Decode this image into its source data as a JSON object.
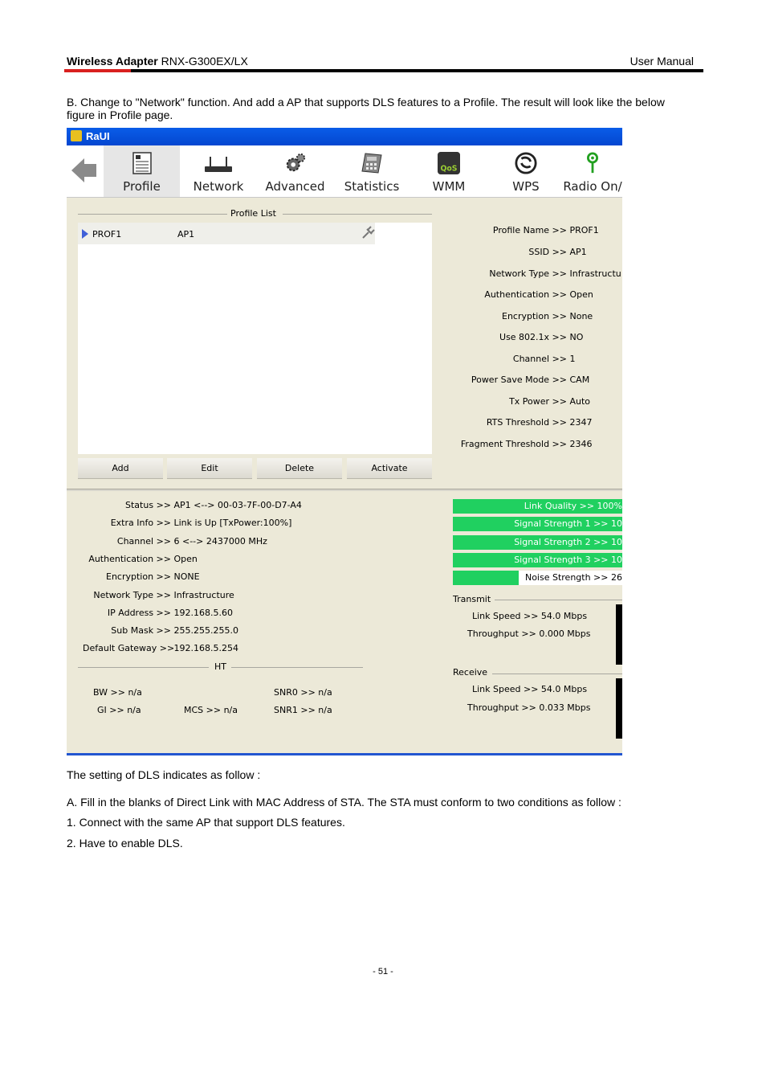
{
  "header": {
    "product_bold": "Wireless Adapter",
    "product_model": " RNX-G300EX/LX",
    "doc_type": "User Manual"
  },
  "intro": {
    "line1": "B. Change to \"Network\" function. And add a AP that supports DLS features to a Profile. The result will look like the below",
    "line2": "figure in Profile page."
  },
  "app": {
    "title": "RaUI",
    "toolbar": [
      {
        "label": "Profile",
        "icon": "profile-icon"
      },
      {
        "label": "Network",
        "icon": "network-icon"
      },
      {
        "label": "Advanced",
        "icon": "advanced-icon"
      },
      {
        "label": "Statistics",
        "icon": "statistics-icon"
      },
      {
        "label": "WMM",
        "icon": "qos-icon"
      },
      {
        "label": "WPS",
        "icon": "wps-icon"
      },
      {
        "label": "Radio On/",
        "icon": "radio-icon"
      }
    ],
    "profile_list": {
      "title": "Profile List",
      "rows": [
        {
          "name": "PROF1",
          "ssid": "AP1"
        }
      ],
      "buttons": {
        "add": "Add",
        "edit": "Edit",
        "delete": "Delete",
        "activate": "Activate"
      }
    },
    "profile_details": [
      {
        "k": "Profile Name >>",
        "v": "PROF1"
      },
      {
        "k": "SSID >>",
        "v": "AP1"
      },
      {
        "k": "Network Type >>",
        "v": "Infrastructu"
      },
      {
        "k": "Authentication >>",
        "v": "Open"
      },
      {
        "k": "Encryption >>",
        "v": "None"
      },
      {
        "k": "Use 802.1x >>",
        "v": "NO"
      },
      {
        "k": "Channel >>",
        "v": "1"
      },
      {
        "k": "Power Save Mode >>",
        "v": "CAM"
      },
      {
        "k": "Tx Power >>",
        "v": "Auto"
      },
      {
        "k": "RTS Threshold >>",
        "v": "2347"
      },
      {
        "k": "Fragment Threshold >>",
        "v": "2346"
      }
    ],
    "status": [
      {
        "k": "Status >>",
        "v": "AP1 <--> 00-03-7F-00-D7-A4"
      },
      {
        "k": "Extra Info >>",
        "v": "Link is Up [TxPower:100%]"
      },
      {
        "k": "Channel >>",
        "v": "6 <--> 2437000 MHz"
      },
      {
        "k": "Authentication >>",
        "v": "Open"
      },
      {
        "k": "Encryption >>",
        "v": "NONE"
      },
      {
        "k": "Network Type >>",
        "v": "Infrastructure"
      },
      {
        "k": "IP Address >>",
        "v": "192.168.5.60"
      },
      {
        "k": "Sub Mask >>",
        "v": "255.255.255.0"
      },
      {
        "k": "Default Gateway >>",
        "v": "192.168.5.254"
      }
    ],
    "ht": {
      "title": "HT",
      "bw": "BW >> n/a",
      "gi": "GI >> n/a",
      "mcs": "MCS >> n/a",
      "snr0": "SNR0 >> n/a",
      "snr1": "SNR1 >> n/a"
    },
    "signal_bars": [
      {
        "label": "Link Quality >> 100%",
        "level": 1.0
      },
      {
        "label": "Signal Strength 1 >> 10",
        "level": 1.0
      },
      {
        "label": "Signal Strength 2 >> 10",
        "level": 1.0
      },
      {
        "label": "Signal Strength 3 >> 10",
        "level": 1.0
      },
      {
        "label": "Noise Strength >> 26",
        "level": 0.39
      }
    ],
    "transmit": {
      "title": "Transmit",
      "link_speed": "Link Speed >>  54.0 Mbps",
      "throughput": "Throughput >>  0.000 Mbps"
    },
    "receive": {
      "title": "Receive",
      "link_speed": "Link Speed >>  54.0 Mbps",
      "throughput": "Throughput >>  0.033 Mbps"
    },
    "colors": {
      "title_bar": "#0a5de8",
      "signal_green": "#20d060",
      "panel": "#ece9d8"
    }
  },
  "body_text": {
    "dls_intro": "The setting of DLS indicates as follow :",
    "step_a": "A. Fill in the blanks of Direct Link with MAC Address of STA. The STA must conform to two conditions as follow :",
    "cond1": "1. Connect with the same AP that support DLS features.",
    "cond2": "2. Have to enable DLS."
  },
  "footer": {
    "page": "- 51 -"
  }
}
